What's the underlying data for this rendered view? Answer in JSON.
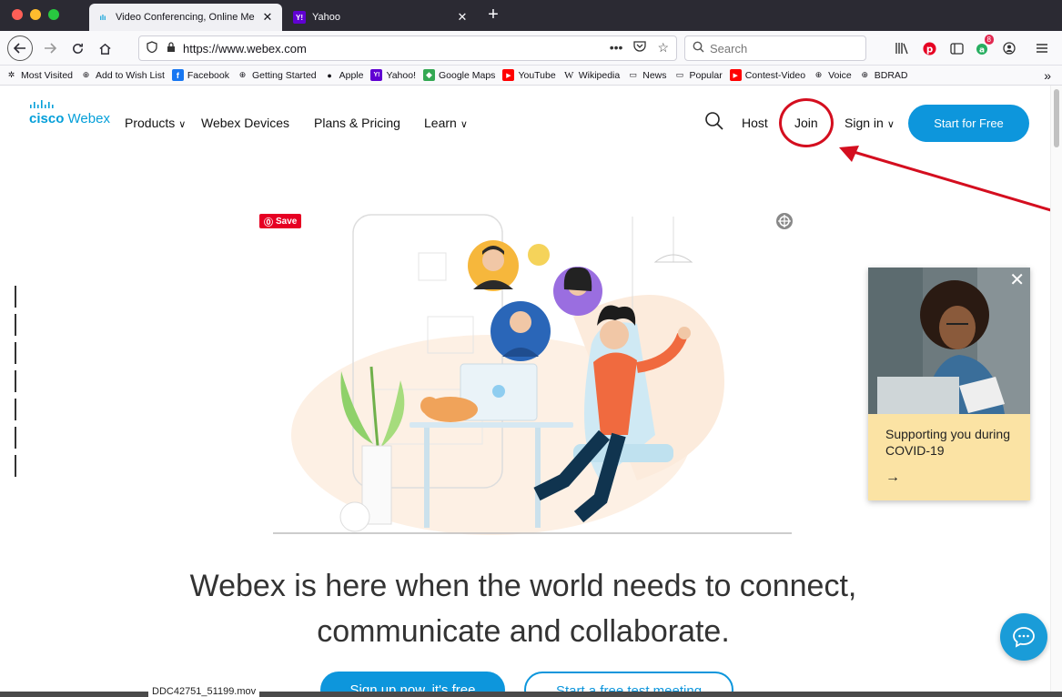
{
  "browser": {
    "tabs": [
      {
        "title": "Video Conferencing, Online Me",
        "favicon": "cisco-icon",
        "active": true
      },
      {
        "title": "Yahoo",
        "favicon": "yahoo-icon",
        "active": false
      }
    ],
    "url": "https://www.webex.com",
    "search_placeholder": "Search",
    "extension_badge": "8",
    "bookmarks": [
      {
        "label": "Most Visited",
        "icon": "gear-icon"
      },
      {
        "label": "Add to Wish List",
        "icon": "globe-icon"
      },
      {
        "label": "Facebook",
        "icon": "facebook-icon"
      },
      {
        "label": "Getting Started",
        "icon": "globe-icon"
      },
      {
        "label": "Apple",
        "icon": "apple-icon"
      },
      {
        "label": "Yahoo!",
        "icon": "yahoo-icon"
      },
      {
        "label": "Google Maps",
        "icon": "maps-icon"
      },
      {
        "label": "YouTube",
        "icon": "youtube-icon"
      },
      {
        "label": "Wikipedia",
        "icon": "wikipedia-icon"
      },
      {
        "label": "News",
        "icon": "folder-icon"
      },
      {
        "label": "Popular",
        "icon": "folder-icon"
      },
      {
        "label": "Contest-Video",
        "icon": "youtube-icon"
      },
      {
        "label": "Voice",
        "icon": "globe-icon"
      },
      {
        "label": "BDRAD",
        "icon": "globe-icon"
      }
    ]
  },
  "site": {
    "logo_cisco": "cisco",
    "logo_webex": "Webex",
    "nav": {
      "products": "Products",
      "devices": "Webex Devices",
      "pricing": "Plans & Pricing",
      "learn": "Learn",
      "host": "Host",
      "join": "Join",
      "signin": "Sign in",
      "start_free": "Start for Free"
    },
    "pin_save": "Save",
    "covid_card": {
      "text": "Supporting you during COVID-19",
      "arrow": "→"
    },
    "headline_line1": "Webex is here when the world needs to connect,",
    "headline_line2": "communicate and collaborate.",
    "cta_primary": "Sign up now, it's free",
    "cta_secondary": "Start a free test meeting"
  },
  "dock_label": "DDC42751_51199.mov",
  "colors": {
    "webex_blue": "#0d96dc",
    "annotation_red": "#d40e1f",
    "covid_card": "#fbe3a4"
  }
}
